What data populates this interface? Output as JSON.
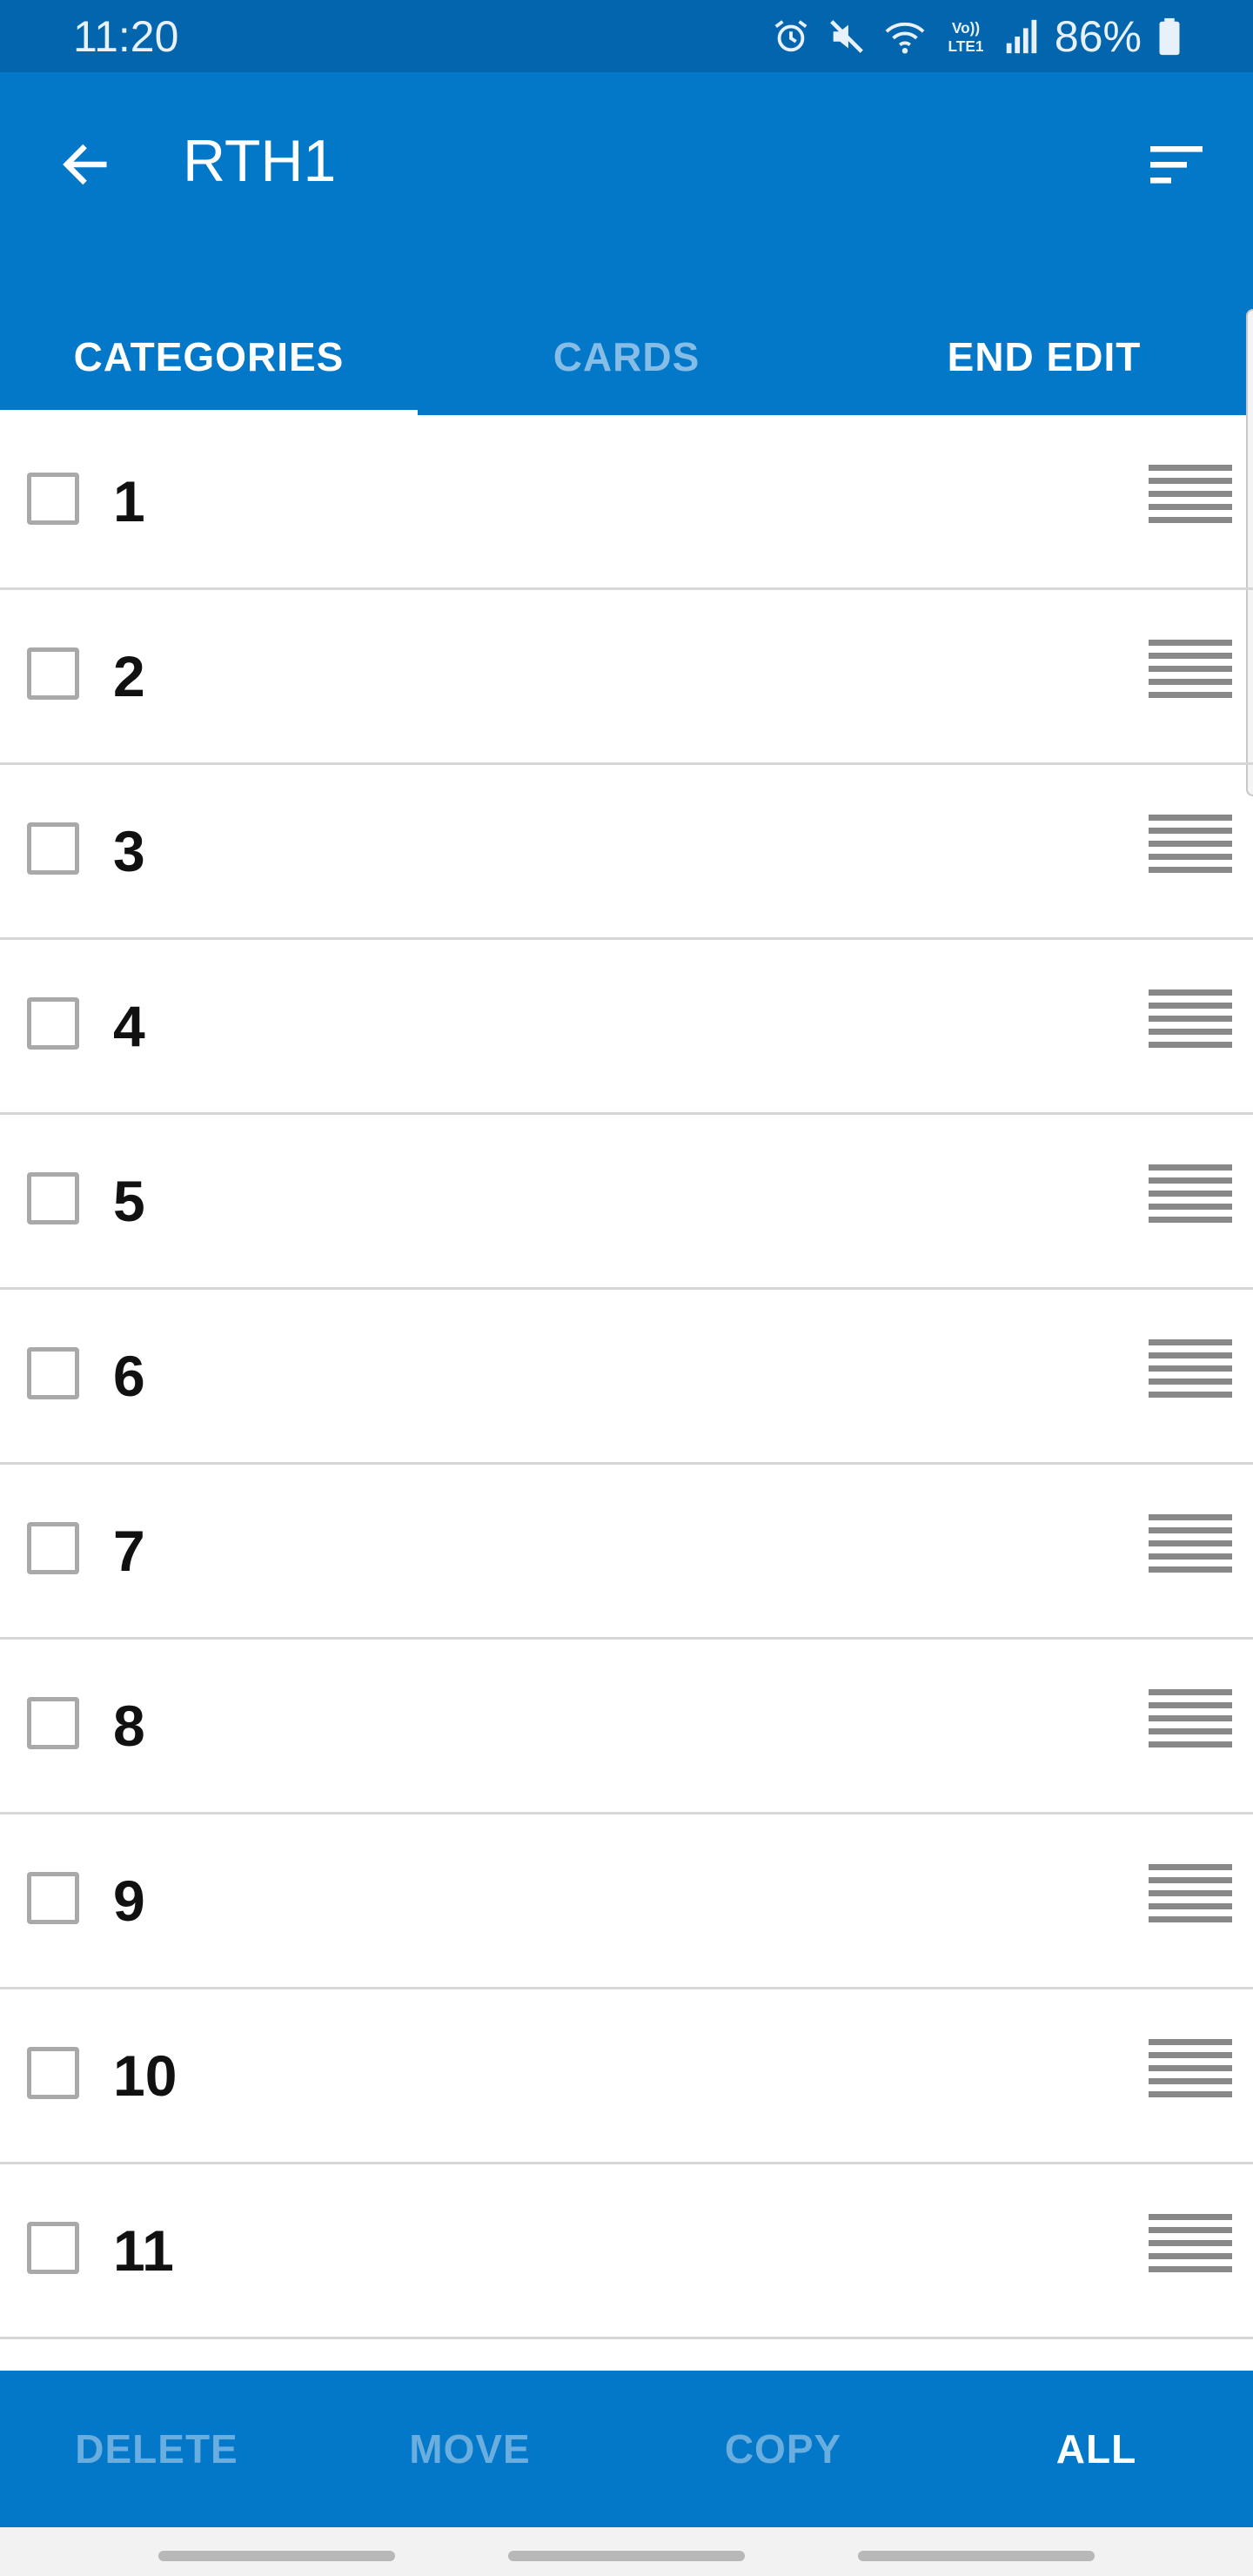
{
  "status_bar": {
    "time": "11:20",
    "battery_percent": "86%",
    "network_label_top": "Vo))",
    "network_label_bottom": "LTE1",
    "icons": [
      "alarm-icon",
      "mute-icon",
      "wifi-icon",
      "volte-icon",
      "signal-icon",
      "battery-icon"
    ]
  },
  "app_bar": {
    "title": "RTH1",
    "back_icon": "arrow-left-icon",
    "sort_icon": "sort-icon"
  },
  "tabs": [
    {
      "label": "CATEGORIES",
      "selected": true
    },
    {
      "label": "CARDS",
      "selected": false
    },
    {
      "label": "END EDIT",
      "selected": false
    }
  ],
  "list": {
    "items": [
      {
        "label": "1",
        "checked": false
      },
      {
        "label": "2",
        "checked": false
      },
      {
        "label": "3",
        "checked": false
      },
      {
        "label": "4",
        "checked": false
      },
      {
        "label": "5",
        "checked": false
      },
      {
        "label": "6",
        "checked": false
      },
      {
        "label": "7",
        "checked": false
      },
      {
        "label": "8",
        "checked": false
      },
      {
        "label": "9",
        "checked": false
      },
      {
        "label": "10",
        "checked": false
      },
      {
        "label": "11",
        "checked": false
      }
    ]
  },
  "bottom_bar": {
    "delete_label": "DELETE",
    "move_label": "MOVE",
    "copy_label": "COPY",
    "all_label": "ALL"
  },
  "colors": {
    "status_bar": "#0365ad",
    "primary": "#0377c8",
    "tab_inactive": "#86bde6",
    "bottom_disabled": "#6aaee0",
    "divider": "#d6d6d6",
    "drag_handle": "#888888"
  }
}
